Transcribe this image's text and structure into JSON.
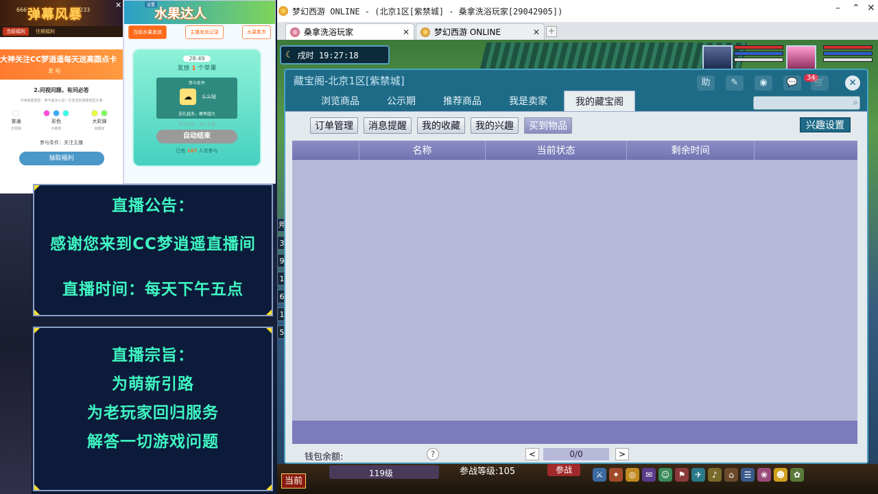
{
  "stream": {
    "danmu": {
      "title": "弹幕风暴",
      "count_left": "666",
      "count_right": "233",
      "tab_active": "当前福利",
      "tab_other": "往期福利",
      "banner_text": "大神关注CC梦逍遥每天送高圆点卡",
      "banner_sub": "发 啦",
      "question": "2.问视问题，有问必答",
      "rule": "可用弹幕类型：参与最多以后一次发送的弹幕类型为准",
      "colors": [
        {
          "label": "普通",
          "sub": "无限制"
        },
        {
          "label": "彩色",
          "sub": "中概率"
        },
        {
          "label": "大彩弹",
          "sub": "高概率"
        }
      ],
      "condition": "参与条件：关注主播",
      "button": "抽取福利"
    },
    "fruit": {
      "settings": "设置",
      "title": "水果达人",
      "tabs": [
        "当前水果发放",
        "主播发放记录",
        "水果集市"
      ],
      "timer": "28:49",
      "issue_prefix": "发放",
      "issue_num": "1",
      "issue_suffix": "个苹果",
      "inner_title": "参与条件",
      "item_name": "么么哒",
      "inner_desc": "送礼越多，概率越大",
      "cond": "参与条件：关注主播",
      "end_button": "自动结束",
      "count_prefix": "已有",
      "count_num": "107",
      "count_suffix": "人次参与"
    },
    "notice1": {
      "lines": [
        "直播公告：",
        "感谢您来到CC梦逍遥直播间",
        "直播时间：每天下午五点"
      ]
    },
    "notice2": {
      "lines": [
        "直播宗旨：",
        "为萌新引路",
        "为老玩家回归服务",
        "解答一切游戏问题"
      ]
    }
  },
  "game": {
    "window_title": "梦幻西游 ONLINE - (北京1区[紫禁城] - 桑拿洗浴玩家[29042905])",
    "controls": {
      "minimize": "–",
      "restore": "⌃",
      "close": "✕"
    },
    "tabs": [
      {
        "label": "桑拿洗浴玩家",
        "active": true
      },
      {
        "label": "梦幻西游 ONLINE",
        "active": false
      }
    ],
    "add_tab": "+",
    "clock": {
      "moon": "☾",
      "text": "戌时 19:27:18"
    },
    "side_numbers": [
      "3",
      "9",
      "1",
      "6",
      "1",
      "5"
    ],
    "side_char": "斧",
    "bottom": {
      "current": "当前",
      "level": "119级",
      "combat_level": "参战等级:105",
      "fight": "参战"
    }
  },
  "dialog": {
    "title": "藏宝阁-北京1区[紫禁城]",
    "icons": {
      "help": "助",
      "edit": "✎",
      "settings": "◉",
      "message": "💬",
      "cart": "🛒"
    },
    "message_badge": "34",
    "close": "✕",
    "main_tabs": [
      "浏览商品",
      "公示期",
      "推荐商品",
      "我是卖家",
      "我的藏宝阁"
    ],
    "active_main_tab": 4,
    "search_placeholder": "",
    "sub_tabs": [
      "订单管理",
      "消息提醒",
      "我的收藏",
      "我的兴趣",
      "买到物品"
    ],
    "active_sub_tab": 4,
    "interest_button": "兴趣设置",
    "columns": [
      "",
      "名称",
      "当前状态",
      "剩余时间",
      ""
    ],
    "wallet_label": "钱包余额:",
    "help": "?",
    "prev": "<",
    "next": ">",
    "page": "0/0"
  },
  "colors": {
    "dialog_bg": "#1e6b88",
    "table_bg": "#b7b8d8",
    "notice_text": "#3ff6c2"
  }
}
